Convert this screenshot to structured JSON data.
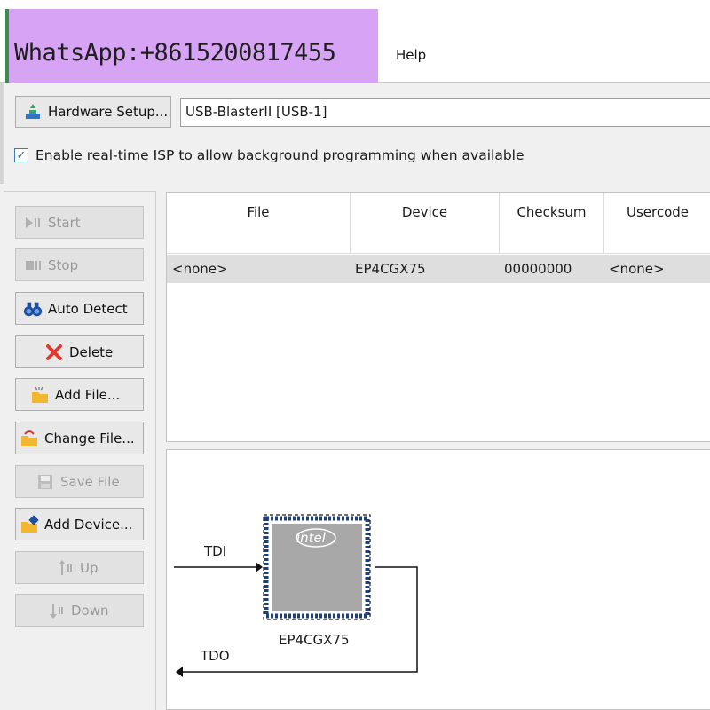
{
  "watermark": {
    "text": "WhatsApp:+8615200817455"
  },
  "menu": {
    "help": "Help"
  },
  "hardware": {
    "setup_label": "Hardware Setup...",
    "selected": "USB-BlasterII [USB-1]",
    "isp_checked": true,
    "isp_label": "Enable real-time ISP to allow background programming when available"
  },
  "sidebar": {
    "start": "Start",
    "stop": "Stop",
    "auto_detect": "Auto Detect",
    "delete": "Delete",
    "add_file": "Add File...",
    "change_file": "Change File...",
    "save_file": "Save File",
    "add_device": "Add Device...",
    "up": "Up",
    "down": "Down"
  },
  "table": {
    "columns": [
      "File",
      "Device",
      "Checksum",
      "Usercode"
    ],
    "rows": [
      {
        "file": "<none>",
        "device": "EP4CGX75",
        "checksum": "00000000",
        "usercode": "<none>"
      }
    ]
  },
  "diagram": {
    "chip_name": "EP4CGX75",
    "chip_logo": "intel",
    "tdi": "TDI",
    "tdo": "TDO"
  },
  "colors": {
    "watermark_bg": "#d6a3f5",
    "selected_row": "#dedede",
    "chip_fill": "#a8a8a8",
    "chip_border": "#1e3f78",
    "delete_red": "#e03a2f"
  }
}
